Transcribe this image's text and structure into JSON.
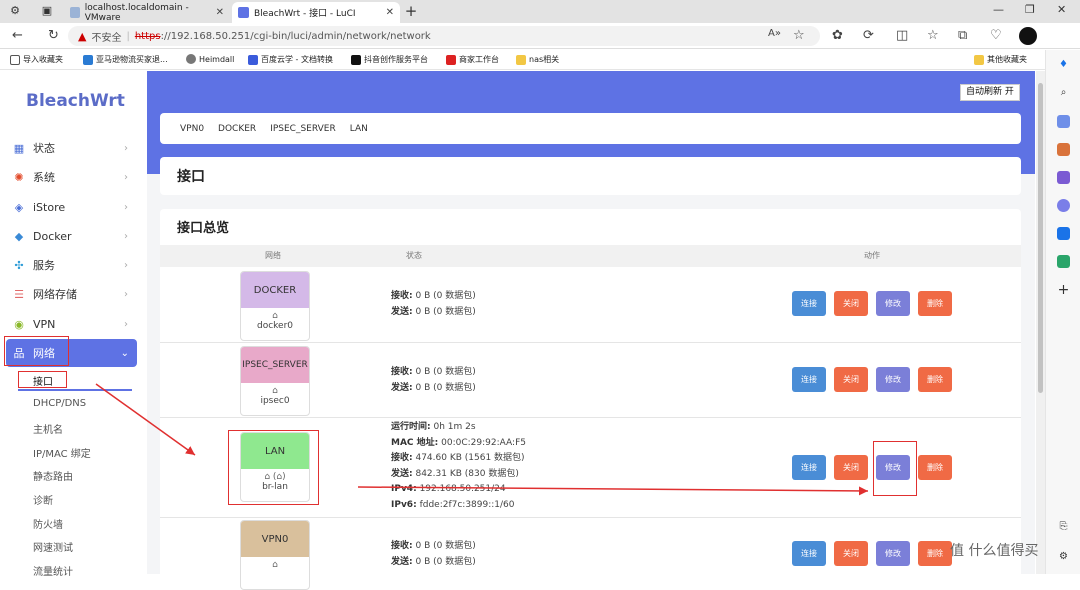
{
  "browser": {
    "tabs": [
      {
        "label": "localhost.localdomain - VMware"
      },
      {
        "label": "BleachWrt - 接口 - LuCI"
      }
    ],
    "security": "不安全",
    "url_scheme": "https",
    "url_rest": "://192.168.50.251/cgi-bin/luci/admin/network/network",
    "bookmarks": [
      "导入收藏夹",
      "亚马逊物流买家退...",
      "Heimdall",
      "百度云学 - 文档转换",
      "抖音创作服务平台",
      "商家工作台",
      "nas相关"
    ],
    "bookmarks_other": "其他收藏夹"
  },
  "sidebar": {
    "logo": "BleachWrt",
    "items": [
      {
        "label": "状态",
        "icon": "grid-icon"
      },
      {
        "label": "系统",
        "icon": "gear-icon"
      },
      {
        "label": "iStore",
        "icon": "box-icon"
      },
      {
        "label": "Docker",
        "icon": "whale-icon"
      },
      {
        "label": "服务",
        "icon": "puzzle-icon"
      },
      {
        "label": "网络存储",
        "icon": "storage-icon"
      },
      {
        "label": "VPN",
        "icon": "vpn-icon"
      },
      {
        "label": "网络",
        "icon": "network-icon"
      }
    ],
    "subitems": [
      "接口",
      "DHCP/DNS",
      "主机名",
      "IP/MAC 绑定",
      "静态路由",
      "诊断",
      "防火墙",
      "网速测试",
      "流量统计"
    ]
  },
  "main": {
    "auto_refresh": "自动刷新 开",
    "tabs": [
      "VPN0",
      "DOCKER",
      "IPSEC_SERVER",
      "LAN"
    ],
    "page_title": "接口",
    "overview_title": "接口总览",
    "col_network": "网络",
    "col_status": "状态",
    "col_action": "动作",
    "actions": {
      "connect": "连接",
      "close": "关闭",
      "edit": "修改",
      "delete": "删除"
    },
    "interfaces": [
      {
        "name": "DOCKER",
        "device": "docker0",
        "color": "#d4b9e8",
        "lines": [
          [
            "接收:",
            "0 B (0 数据包)"
          ],
          [
            "发送:",
            "0 B (0 数据包)"
          ]
        ]
      },
      {
        "name": "IPSEC_SERVER",
        "device": "ipsec0",
        "color": "#e8a9c9",
        "lines": [
          [
            "接收:",
            "0 B (0 数据包)"
          ],
          [
            "发送:",
            "0 B (0 数据包)"
          ]
        ]
      },
      {
        "name": "LAN",
        "device": "br-lan",
        "color": "#8fe88f",
        "lines": [
          [
            "运行时间:",
            "0h 1m 2s"
          ],
          [
            "MAC 地址:",
            "00:0C:29:92:AA:F5"
          ],
          [
            "接收:",
            "474.60 KB (1561 数据包)"
          ],
          [
            "发送:",
            "842.31 KB (830 数据包)"
          ],
          [
            "IPv4:",
            "192.168.50.251/24"
          ],
          [
            "IPv6:",
            "fdde:2f7c:3899::1/60"
          ]
        ]
      },
      {
        "name": "VPN0",
        "device": "",
        "color": "#d9c09c",
        "lines": [
          [
            "接收:",
            "0 B (0 数据包)"
          ],
          [
            "发送:",
            "0 B (0 数据包)"
          ]
        ]
      }
    ]
  },
  "watermark": "值 什么值得买"
}
